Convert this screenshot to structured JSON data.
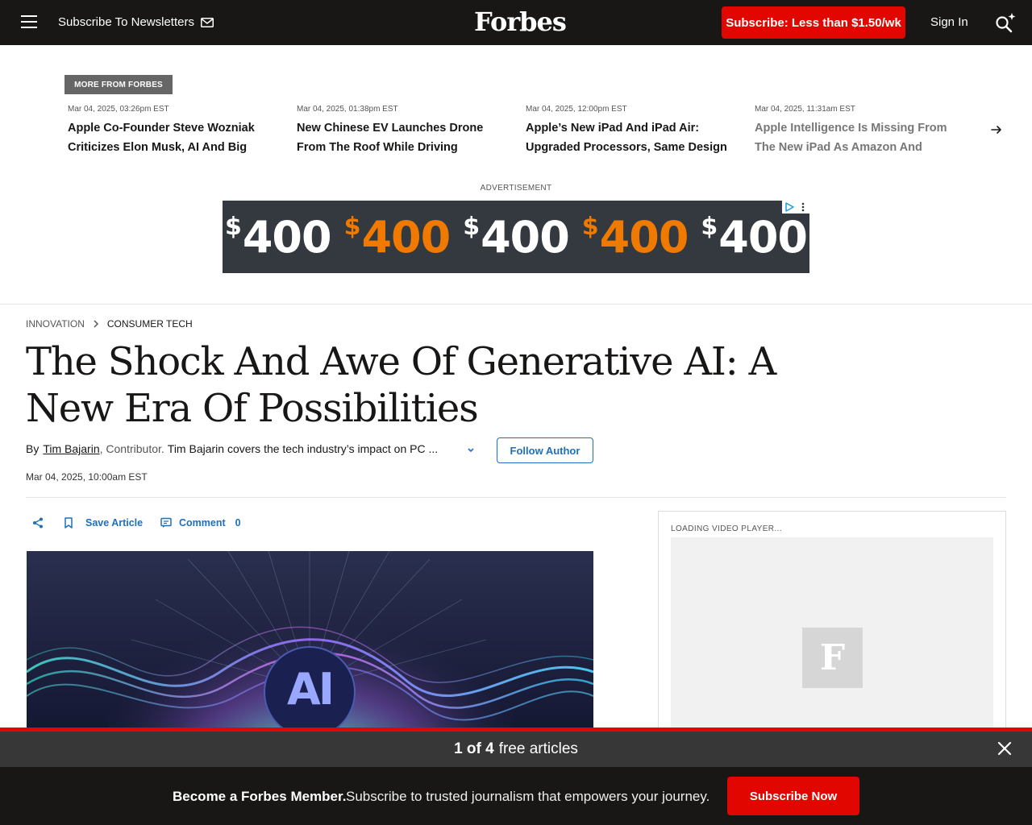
{
  "header": {
    "subscribe_newsletters": "Subscribe To Newsletters",
    "logo": "Forbes",
    "subscribe_cta": "Subscribe: Less than $1.50/wk",
    "sign_in": "Sign In"
  },
  "more_from_forbes": {
    "label": "MORE FROM FORBES",
    "items": [
      {
        "date": "Mar 04, 2025, 03:26pm EST",
        "headline": "Apple Co-Founder Steve Wozniak Criticizes Elon Musk, AI And Big Tech..."
      },
      {
        "date": "Mar 04, 2025, 01:38pm EST",
        "headline": "New Chinese EV Launches Drone From The Roof While Driving"
      },
      {
        "date": "Mar 04, 2025, 12:00pm EST",
        "headline": "Apple’s New iPad And iPad Air: Upgraded Processors, Same Design"
      },
      {
        "date": "Mar 04, 2025, 11:31am EST",
        "headline": "Apple Intelligence Is Missing From The New iPad As Amazon And Google..."
      }
    ]
  },
  "ad": {
    "label": "ADVERTISEMENT",
    "currency": "$",
    "amount": "400"
  },
  "article": {
    "breadcrumb": [
      "INNOVATION",
      "CONSUMER TECH"
    ],
    "title": "The Shock And Awe Of Generative AI: A New Era Of Possibilities",
    "by": "By",
    "author": "Tim Bajarin",
    "role": ", Contributor.",
    "bio": "Tim Bajarin covers the tech industry’s impact on PC ...",
    "follow_label": "Follow Author",
    "date": "Mar 04, 2025, 10:00am EST",
    "hero_text": "AI"
  },
  "actions": {
    "save_label": "Save Article",
    "comment_label": "Comment",
    "comment_count": "0"
  },
  "video": {
    "loading_label": "LOADING VIDEO PLAYER...",
    "placeholder_logo": "F"
  },
  "paywall": {
    "count": "1 of 4",
    "free_text": "free articles",
    "member_title": "Become a Forbes Member.",
    "member_desc": "Subscribe to trusted journalism that empowers your journey.",
    "subscribe_now": "Subscribe Now"
  },
  "colors": {
    "brand_red": "#e10600",
    "link_blue": "#1e6fbf",
    "dark": "#181716",
    "ad_orange": "#f07a00"
  }
}
